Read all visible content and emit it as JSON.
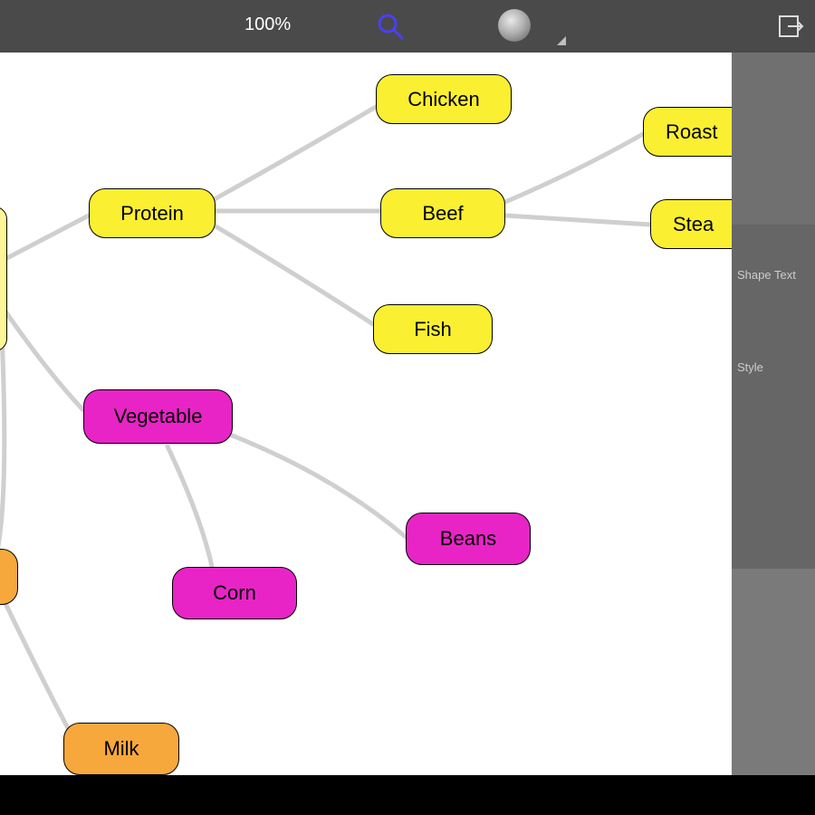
{
  "toolbar": {
    "zoom": "100%",
    "search_icon": "search-icon",
    "color_icon": "color-swatch",
    "export_icon": "export-icon"
  },
  "sidebar": {
    "labels": {
      "shape_text": "Shape Text",
      "style": "Style"
    }
  },
  "nodes": {
    "root": "",
    "protein": "Protein",
    "chicken": "Chicken",
    "beef": "Beef",
    "fish": "Fish",
    "roast": "Roast",
    "steak": "Stea",
    "vegetable": "Vegetable",
    "beans": "Beans",
    "corn": "Corn",
    "dairy": "",
    "milk": "Milk"
  },
  "colors": {
    "yellow": "#fbef32",
    "yellow_root": "#fdf698",
    "magenta": "#e824c6",
    "orange": "#f7a83c"
  }
}
